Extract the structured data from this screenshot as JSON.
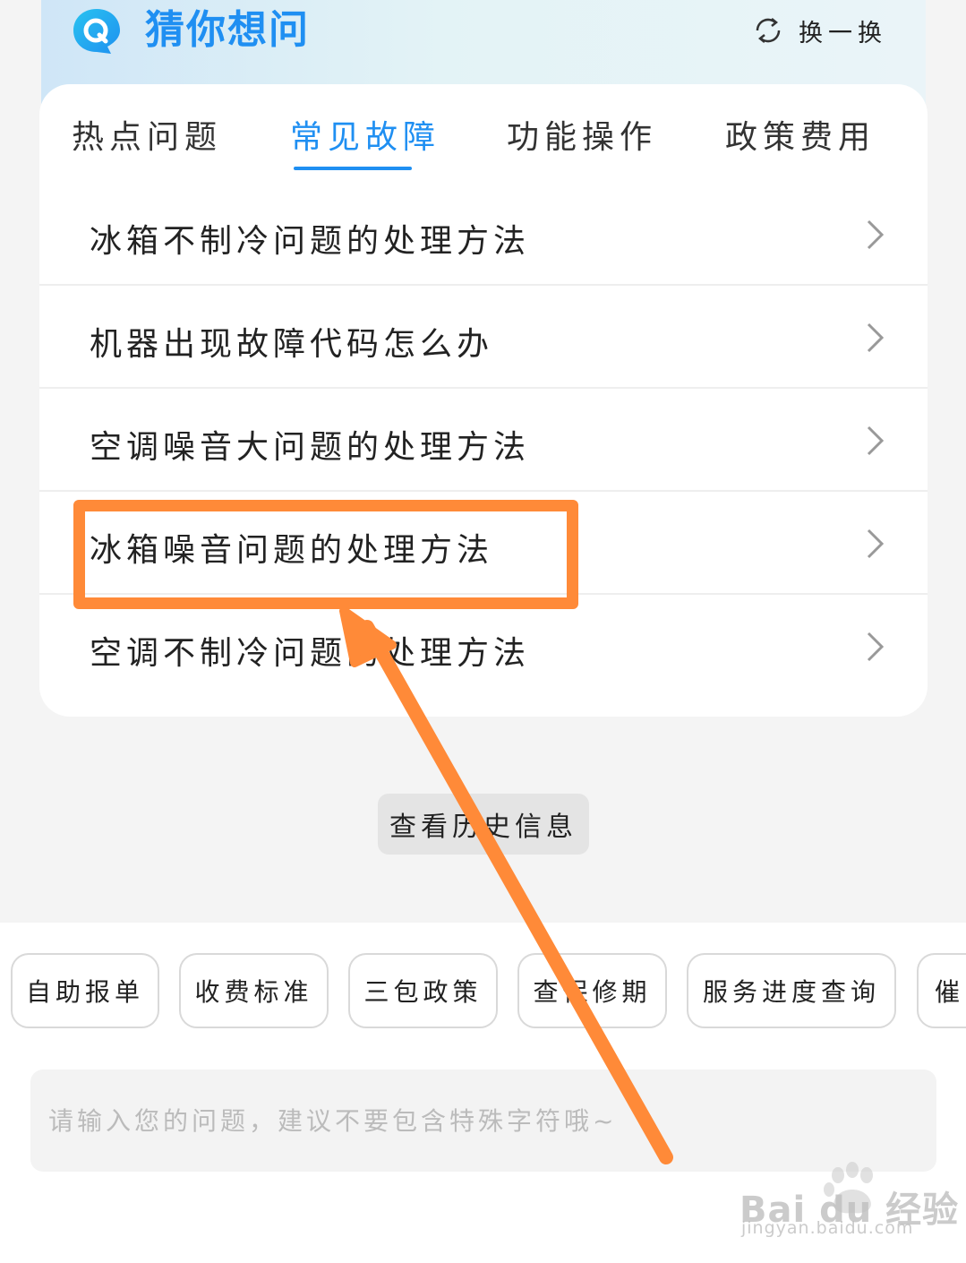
{
  "header": {
    "title": "猜你想问",
    "refresh_label": "换一换",
    "colors": {
      "accent": "#1f8ff2",
      "annotation": "#ff8a38"
    }
  },
  "tabs": [
    {
      "label": "热点问题",
      "active": false
    },
    {
      "label": "常见故障",
      "active": true
    },
    {
      "label": "功能操作",
      "active": false
    },
    {
      "label": "政策费用",
      "active": false
    }
  ],
  "questions": [
    {
      "label": "冰箱不制冷问题的处理方法"
    },
    {
      "label": "机器出现故障代码怎么办"
    },
    {
      "label": "空调噪音大问题的处理方法"
    },
    {
      "label": "冰箱噪音问题的处理方法"
    },
    {
      "label": "空调不制冷问题的处理方法"
    }
  ],
  "history_button": "查看历史信息",
  "quick_chips": [
    {
      "label": "自助报单"
    },
    {
      "label": "收费标准"
    },
    {
      "label": "三包政策"
    },
    {
      "label": "查保修期"
    },
    {
      "label": "服务进度查询"
    },
    {
      "label": "催"
    }
  ],
  "input": {
    "value": "",
    "placeholder": "请输入您的问题，建议不要包含特殊字符哦~"
  },
  "watermark": {
    "brand": "Bai du 经验",
    "url": "jingyan.baidu.com"
  }
}
